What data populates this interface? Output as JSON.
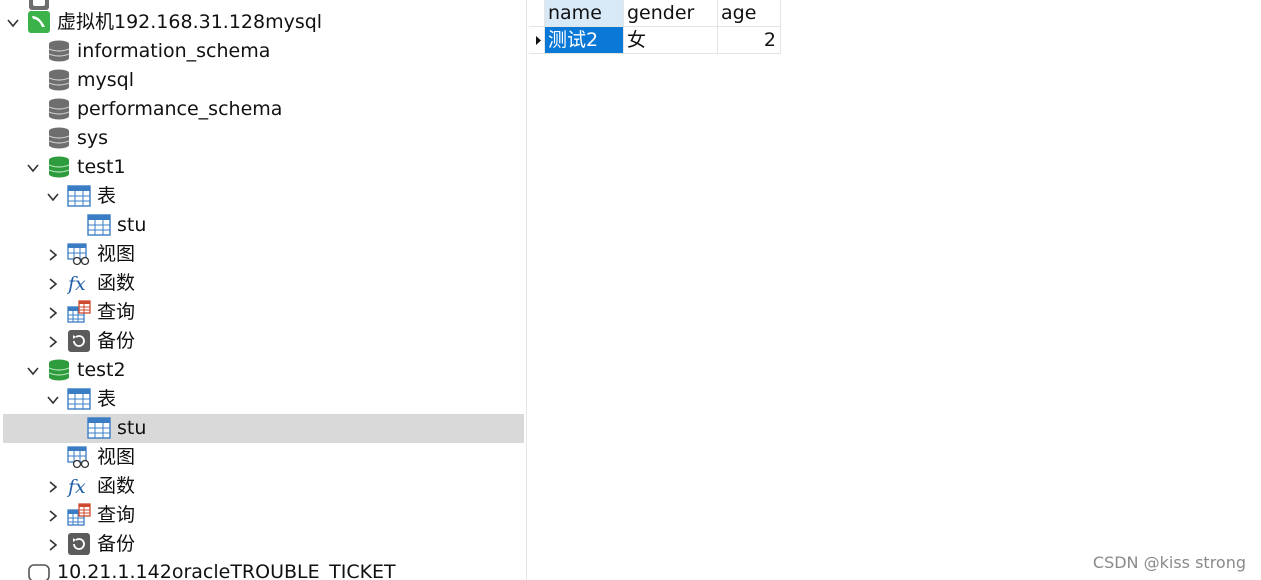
{
  "tree": {
    "conn_top_partial": "",
    "connection": "虚拟机192.168.31.128mysql",
    "dbs": [
      "information_schema",
      "mysql",
      "performance_schema",
      "sys"
    ],
    "test1": {
      "name": "test1",
      "tables_label": "表",
      "table": "stu",
      "views_label": "视图",
      "functions_label": "函数",
      "queries_label": "查询",
      "backups_label": "备份"
    },
    "test2": {
      "name": "test2",
      "tables_label": "表",
      "table": "stu",
      "views_label": "视图",
      "functions_label": "函数",
      "queries_label": "查询",
      "backups_label": "备份"
    },
    "next_connection": "10.21.1.142oracleTROUBLE_TICKET"
  },
  "grid": {
    "columns": [
      "name",
      "gender",
      "age"
    ],
    "rows": [
      [
        "测试2",
        "女",
        "2"
      ]
    ]
  },
  "watermark": "CSDN @kiss strong",
  "colors": {
    "db_green": "#2e9b3c",
    "db_gray": "#6e6e6e",
    "selection_blue": "#0a78d7",
    "tree_selected": "#d9d9d9"
  }
}
